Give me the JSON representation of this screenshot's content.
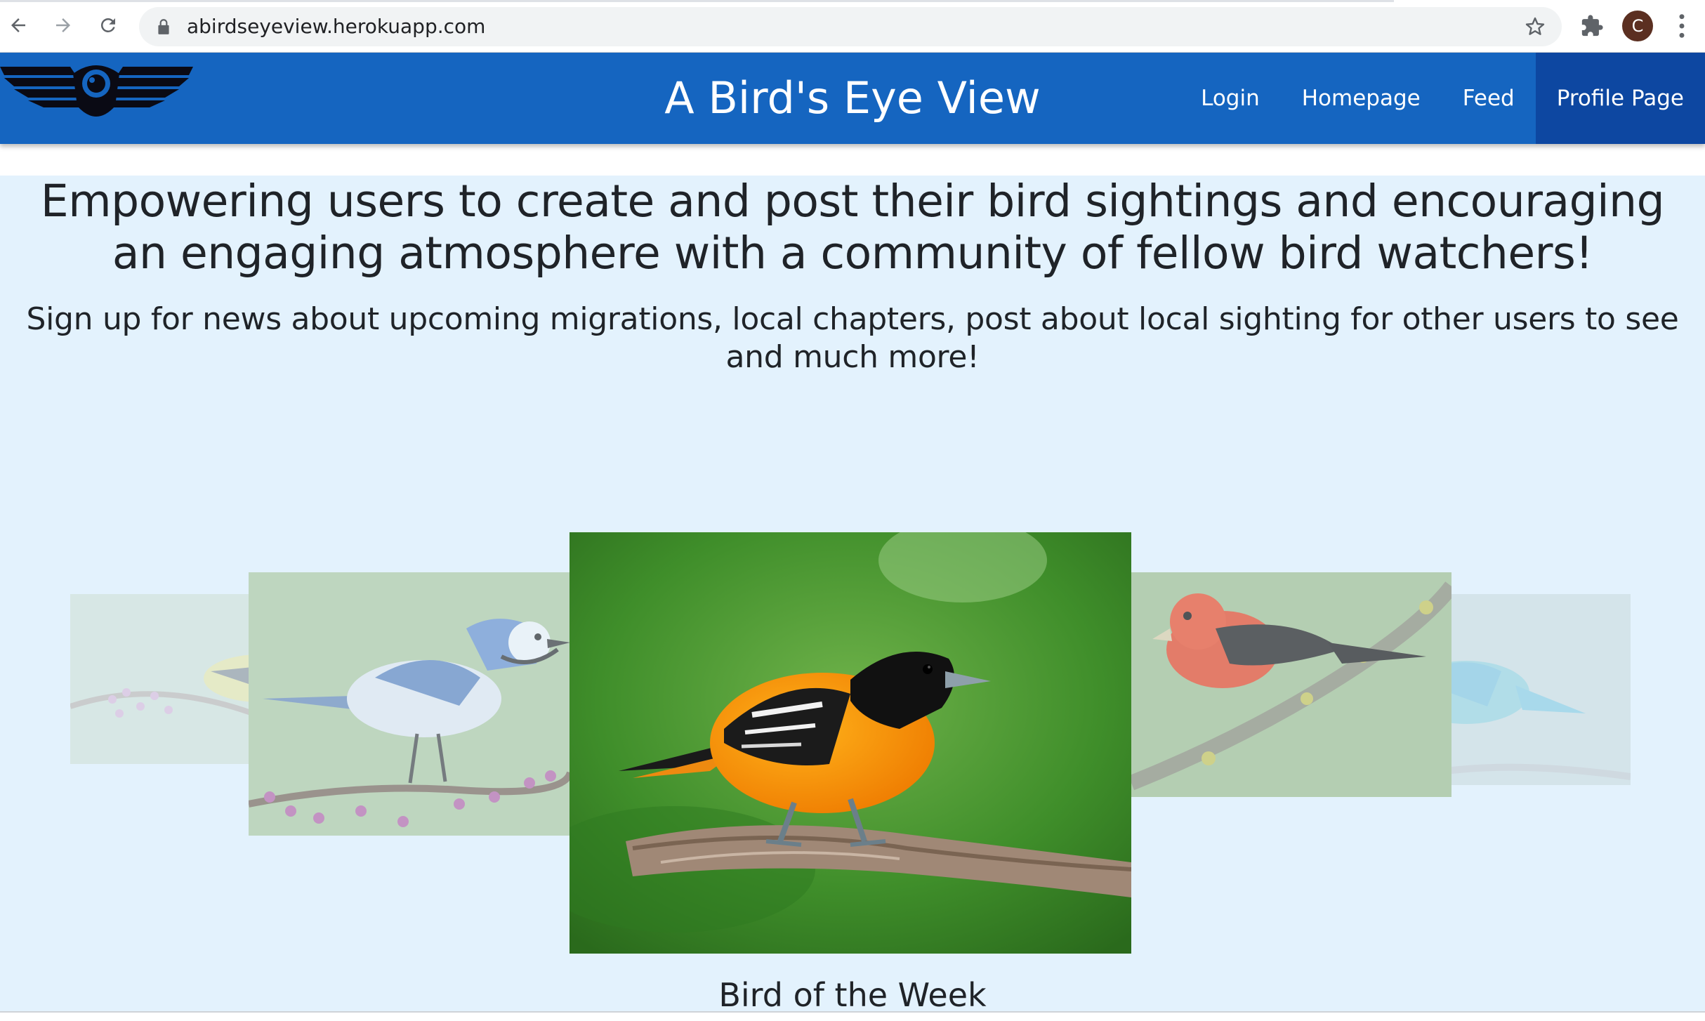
{
  "browser": {
    "url": "abirdseyeview.herokuapp.com",
    "profile_initial": "C",
    "back_icon": "arrow-left-icon",
    "forward_icon": "arrow-right-icon",
    "reload_icon": "reload-icon",
    "bookmark_icon": "star-icon",
    "extensions_icon": "puzzle-icon",
    "menu_icon": "kebab-icon"
  },
  "navbar": {
    "title": "A Bird's Eye View",
    "logo_icon": "winged-eye-logo",
    "links": [
      {
        "label": "Login"
      },
      {
        "label": "Homepage"
      },
      {
        "label": "Feed"
      },
      {
        "label": "Profile Page",
        "active": true
      }
    ],
    "color": "#1565c0"
  },
  "hero": {
    "heading": "Empowering users to create and post their bird sightings and encouraging an engaging atmosphere with a community of fellow bird watchers!",
    "subheading": "Sign up for news about upcoming migrations, local chapters, post about local sighting for other users to see and much more!",
    "background": "#e3f2fd"
  },
  "carousel": {
    "slides": [
      {
        "bird": "American Goldfinch"
      },
      {
        "bird": "Blue Jay"
      },
      {
        "bird": "Baltimore Oriole",
        "active": true
      },
      {
        "bird": "Scarlet Tanager"
      },
      {
        "bird": "Bluebird"
      }
    ],
    "caption": "Bird of the Week"
  }
}
